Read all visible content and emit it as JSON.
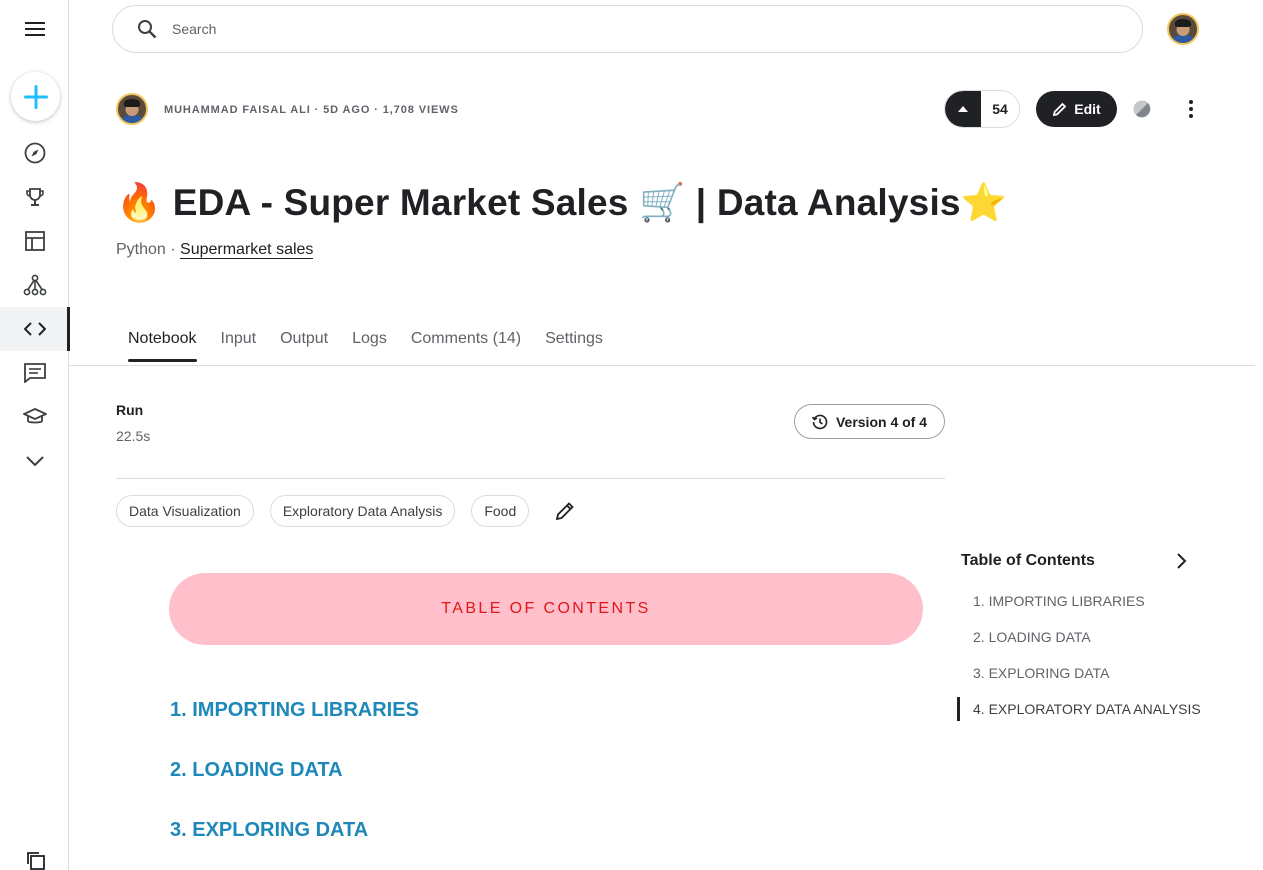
{
  "search": {
    "placeholder": "Search"
  },
  "notebook": {
    "meta": "MUHAMMAD FAISAL ALI · 5D AGO · 1,708 VIEWS",
    "upvotes": "54",
    "edit_label": "Edit",
    "title": "🔥 EDA - Super Market Sales 🛒 | Data Analysis⭐",
    "language": "Python",
    "separator": " · ",
    "dataset_link": "Supermarket sales"
  },
  "tabs": [
    {
      "label": "Notebook",
      "active": true
    },
    {
      "label": "Input"
    },
    {
      "label": "Output"
    },
    {
      "label": "Logs"
    },
    {
      "label": "Comments (14)"
    },
    {
      "label": "Settings"
    }
  ],
  "run": {
    "label": "Run",
    "time": "22.5s",
    "version_label": "Version 4 of 4"
  },
  "tags": [
    "Data Visualization",
    "Exploratory Data Analysis",
    "Food"
  ],
  "content": {
    "toc_banner": "TABLE OF CONTENTS",
    "sections": [
      "1. IMPORTING LIBRARIES",
      "2. LOADING DATA",
      "3. EXPLORING DATA"
    ]
  },
  "side_toc": {
    "title": "Table of Contents",
    "items": [
      "1. IMPORTING LIBRARIES",
      "2. LOADING DATA",
      "3. EXPLORING DATA",
      "4. EXPLORATORY DATA ANALYSIS"
    ],
    "active_index": 3
  },
  "colors": {
    "accent": "#20BEFF",
    "link_blue": "#1E88B8",
    "banner_bg": "#FFC0CB",
    "banner_text": "#E0161B",
    "dark": "#202124"
  }
}
